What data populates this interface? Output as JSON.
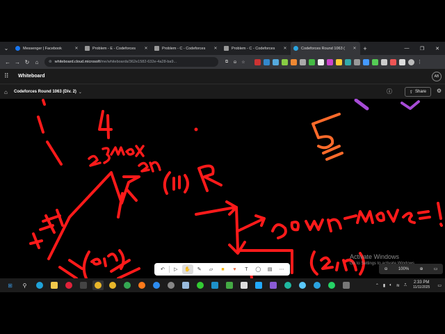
{
  "tabs": [
    {
      "title": "Messenger | Facebook",
      "color": "#1877f2",
      "active": false
    },
    {
      "title": "Problem - E - Codeforces",
      "color": "#aaaaaa",
      "active": false
    },
    {
      "title": "Problem - C - Codeforces",
      "color": "#aaaaaa",
      "active": false
    },
    {
      "title": "Problem - C - Codeforces",
      "color": "#aaaaaa",
      "active": false
    },
    {
      "title": "Codeforces Round 1063 (",
      "color": "#2aa5e0",
      "active": true
    }
  ],
  "address": {
    "host": "whiteboard.cloud.microsoft",
    "path": "/me/whiteboards/362e1582-632e-4a28-ba9..."
  },
  "app": {
    "name": "Whiteboard",
    "avatar": "AB"
  },
  "board": {
    "title": "Codeforces Round 1063 (Div. 2)",
    "share_label": "Share"
  },
  "canvas_text": {
    "activate_title": "Activate Windows",
    "activate_sub": "Go to Settings to activate Windows."
  },
  "zoom": {
    "level": "100%"
  },
  "clock": {
    "time": "2:33 PM",
    "date": "11/11/2025"
  },
  "colors": {
    "ink_red": "#ff1a1a",
    "ink_orange": "#ff6a2a",
    "ink_purple": "#a64bd6",
    "background": "#000000"
  }
}
